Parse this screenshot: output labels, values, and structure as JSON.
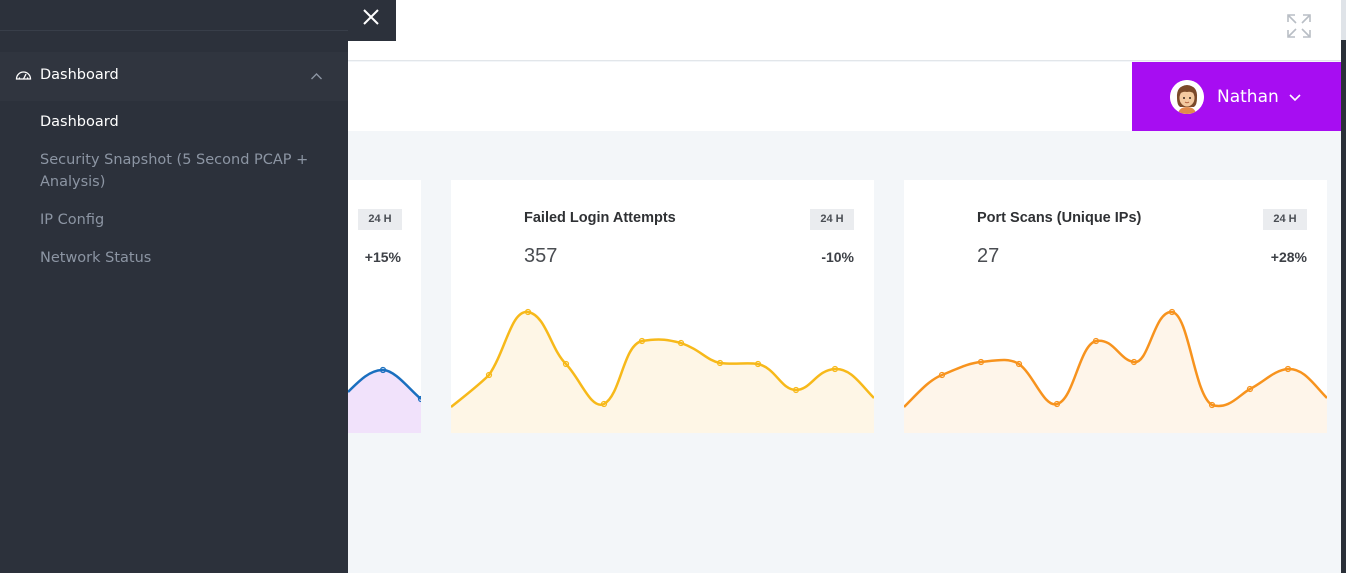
{
  "header": {
    "user_name": "Nathan"
  },
  "sidebar": {
    "section_label": "Dashboard",
    "items": [
      {
        "label": "Dashboard",
        "active": true
      },
      {
        "label": "Security Snapshot (5 Second PCAP + Analysis)",
        "active": false
      },
      {
        "label": "IP Config",
        "active": false
      },
      {
        "label": "Network Status",
        "active": false
      }
    ]
  },
  "icons": {
    "close": "close-icon",
    "expand": "fullscreen-icon",
    "dashboard": "dashboard-gauge-icon",
    "section_toggle": "chevron-up-icon",
    "user_menu": "chevron-down-icon"
  },
  "colors": {
    "accent": "#a70df2",
    "sidebar_bg": "#2c313b",
    "card1_line": "#1a6fbf",
    "card1_fill": "#f1e2fb",
    "card2_line": "#f7b91a",
    "card2_fill": "#fef6e6",
    "card3_line": "#f7931e",
    "card3_fill": "#fef5ea"
  },
  "cards": [
    {
      "title": "",
      "value": "",
      "badge": "24 H",
      "change": "+15%"
    },
    {
      "title": "Failed Login Attempts",
      "value": "357",
      "badge": "24 H",
      "change": "-10%"
    },
    {
      "title": "Port Scans (Unique IPs)",
      "value": "27",
      "badge": "24 H",
      "change": "+28%"
    }
  ]
}
